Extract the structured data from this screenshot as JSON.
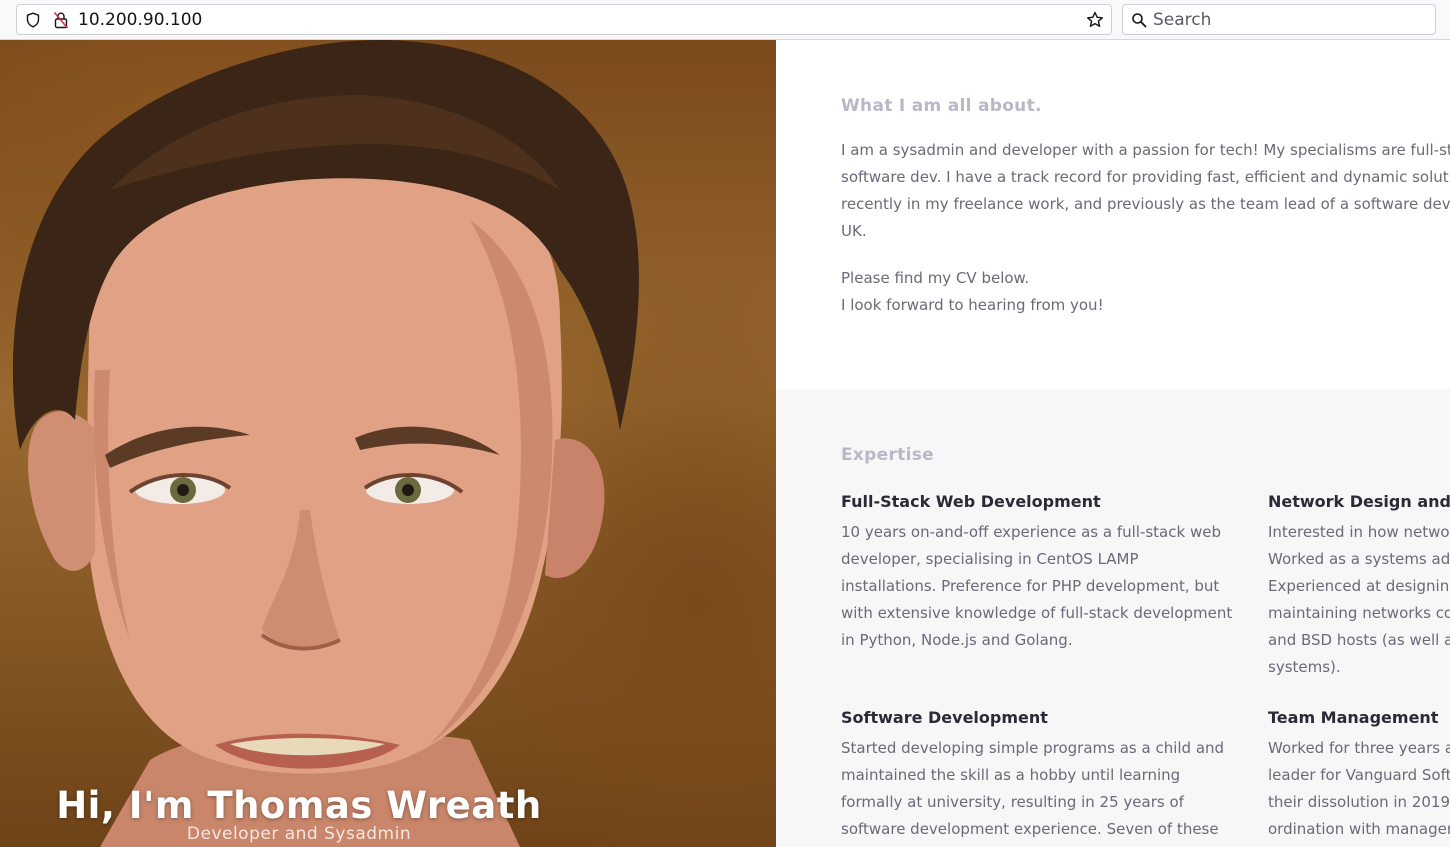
{
  "browser": {
    "url": "10.200.90.100",
    "search_placeholder": "Search"
  },
  "hero": {
    "name": "Hi, I'm Thomas Wreath",
    "subtitle": "Developer and Sysadmin"
  },
  "about": {
    "title": "What I am all about.",
    "lines": [
      "I am a sysadmin and developer with a passion for tech! My specialisms are full-st",
      "software dev. I have a track record for providing fast, efficient and dynamic solut",
      "recently in my freelance work, and previously as the team lead of a software dev",
      "UK."
    ],
    "cv_line": "Please find my CV below.",
    "closing_line": "I look forward to hearing from you!"
  },
  "expertise": {
    "title": "Expertise",
    "items": [
      {
        "title": "Full-Stack Web Development",
        "lines": [
          "10 years on-and-off experience as a full-stack web",
          "developer, specialising in CentOS LAMP",
          "installations. Preference for PHP development, but",
          "with extensive knowledge of full-stack development",
          "in Python, Node.js and Golang."
        ]
      },
      {
        "title": "Network Design and",
        "lines": [
          "Interested in how netwo",
          "Worked as a systems ad",
          "Experienced at designin",
          "maintaining networks co",
          "and BSD hosts (as well a",
          "systems)."
        ]
      },
      {
        "title": "Software Development",
        "lines": [
          "Started developing simple programs as a child and",
          "maintained the skill as a hobby until learning",
          "formally at university, resulting in 25 years of",
          "software development experience. Seven of these"
        ]
      },
      {
        "title": "Team Management",
        "lines": [
          "Worked for three years a",
          "leader for Vanguard Soft",
          "their dissolution in 2019",
          "ordination with manager"
        ]
      }
    ]
  }
}
